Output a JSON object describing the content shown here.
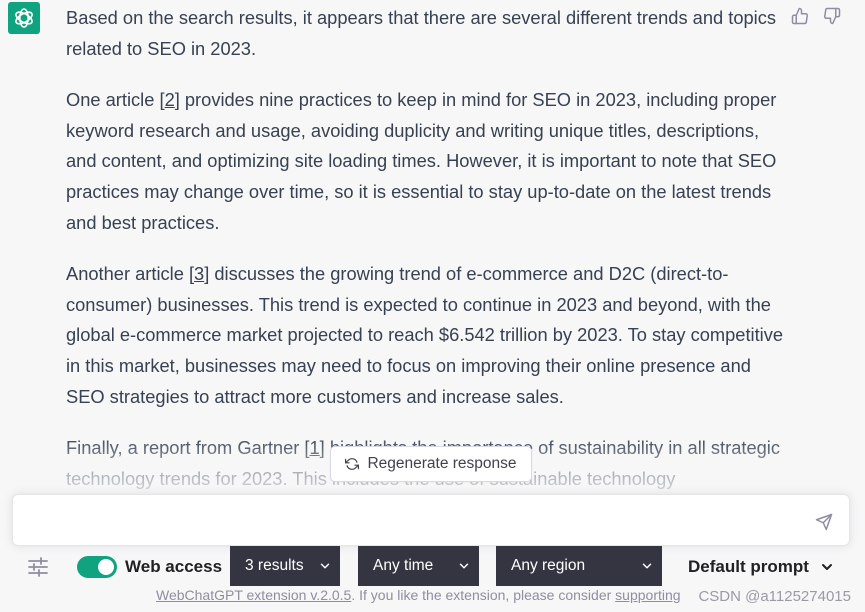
{
  "message": {
    "p1": "Based on the search results, it appears that there are several different trends and topics related to SEO in 2023.",
    "p2_pre": "One article [",
    "p2_cite": "2",
    "p2_post": "] provides nine practices to keep in mind for SEO in 2023, including proper keyword research and usage, avoiding duplicity and writing unique titles, descriptions, and content, and optimizing site loading times. However, it is important to note that SEO practices may change over time, so it is essential to stay up-to-date on the latest trends and best practices.",
    "p3_pre": "Another article [",
    "p3_cite": "3",
    "p3_post": "] discusses the growing trend of e-commerce and D2C (direct-to-consumer) businesses. This trend is expected to continue in 2023 and beyond, with the global e-commerce market projected to reach $6.542 trillion by 2023. To stay competitive in this market, businesses may need to focus on improving their online presence and SEO strategies to attract more customers and increase sales.",
    "p4_pre": "Finally, a report from Gartner [",
    "p4_cite": "1",
    "p4_post": "] highlights the importance of sustainability in all strategic technology trends for 2023. This includes the use of sustainable technology"
  },
  "regenerate_label": "Regenerate response",
  "input": {
    "value": "",
    "placeholder": ""
  },
  "toolbar": {
    "web_access_label": "Web access",
    "web_access_on": true,
    "results_select": "3 results",
    "time_select": "Any time",
    "region_select": "Any region",
    "prompt_select": "Default prompt"
  },
  "footer": {
    "link_text": "WebChatGPT extension v.2.0.5",
    "text": ". If you like the extension, please consider ",
    "support_link": "supporting"
  },
  "watermark": "CSDN @a1125274015",
  "colors": {
    "accent": "#10a37f",
    "select_bg": "#343541",
    "background": "#f7f7f8"
  },
  "icons": [
    "openai-logo-icon",
    "thumbs-up-icon",
    "thumbs-down-icon",
    "refresh-icon",
    "send-icon",
    "settings-sliders-icon",
    "chevron-down-icon"
  ]
}
